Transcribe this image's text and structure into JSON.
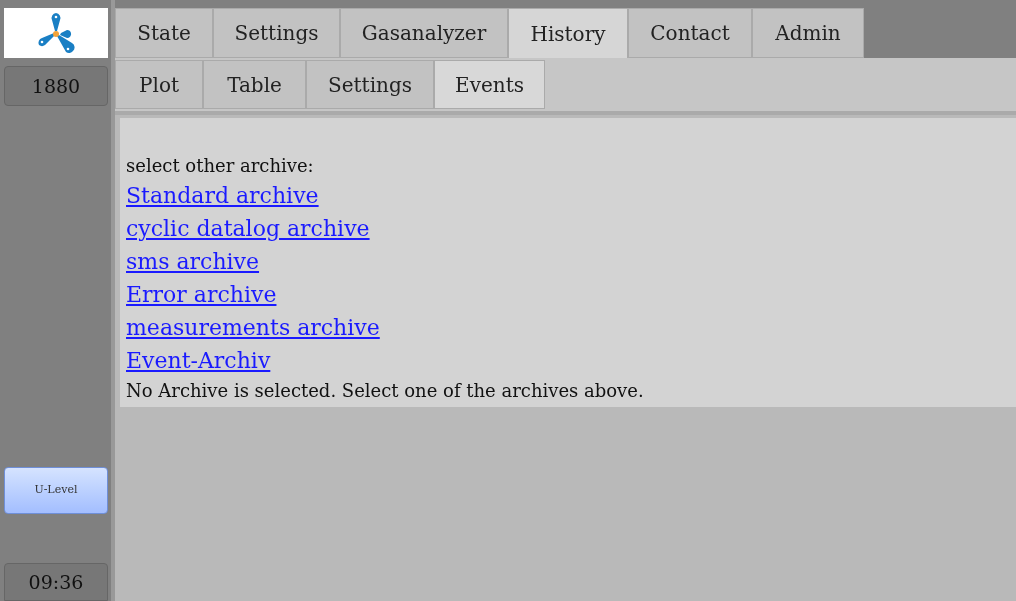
{
  "sidebar": {
    "counter": "1880",
    "level_button": "U-Level",
    "time": "09:36"
  },
  "tabs": [
    {
      "label": "State",
      "selected": false
    },
    {
      "label": "Settings",
      "selected": false
    },
    {
      "label": "Gasanalyzer",
      "selected": false
    },
    {
      "label": "History",
      "selected": true
    },
    {
      "label": "Contact",
      "selected": false
    },
    {
      "label": "Admin",
      "selected": false
    }
  ],
  "subtabs": [
    {
      "label": "Plot",
      "selected": false
    },
    {
      "label": "Table",
      "selected": false
    },
    {
      "label": "Settings",
      "selected": false
    },
    {
      "label": "Events",
      "selected": true
    }
  ],
  "content": {
    "prompt": "select other archive:",
    "links": [
      "Standard archive",
      "cyclic datalog archive",
      "sms archive",
      "Error archive",
      "measurements archive",
      "Event-Archiv"
    ],
    "status": "No Archive is selected. Select one of the archives above."
  }
}
